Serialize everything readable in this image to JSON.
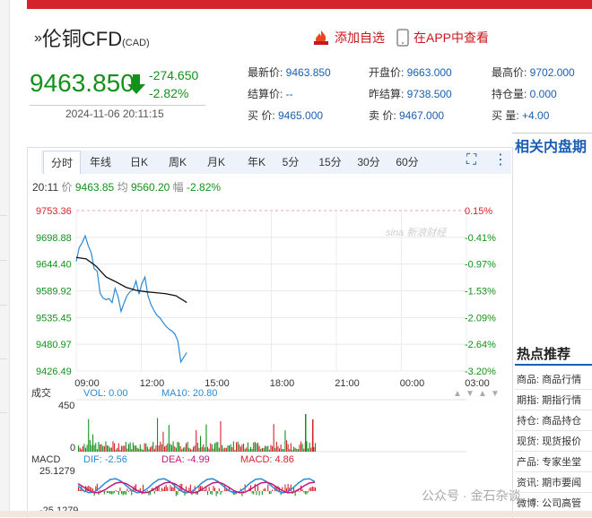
{
  "header": {
    "title_prefix": "»",
    "title": "伦铜CFD",
    "currency": "(CAD)",
    "add_watchlist": "添加自选",
    "view_in_app": "在APP中查看"
  },
  "quote": {
    "price": "9463.850",
    "change": "-274.650",
    "change_pct": "-2.82%",
    "timestamp": "2024-11-06 20:11:15",
    "fields": [
      {
        "label": "最新价:",
        "value": "9463.850"
      },
      {
        "label": "开盘价:",
        "value": "9663.000"
      },
      {
        "label": "最高价:",
        "value": "9702.000"
      },
      {
        "label": "结算价:",
        "value": "--"
      },
      {
        "label": "昨结算:",
        "value": "9738.500"
      },
      {
        "label": "持仓量:",
        "value": "0.000"
      },
      {
        "label": "买  价:",
        "value": "9465.000"
      },
      {
        "label": "卖  价:",
        "value": "9467.000"
      },
      {
        "label": "买  量:",
        "value": "+4.00"
      }
    ]
  },
  "tabs": [
    "分时",
    "年线",
    "日K",
    "周K",
    "月K",
    "年K",
    "5分",
    "15分",
    "30分",
    "60分"
  ],
  "info_line": {
    "time": "20:11",
    "price_label": "价",
    "price": "9463.85",
    "avg_label": "均",
    "avg": "9560.20",
    "amp_label": "幅",
    "amp": "-2.82%"
  },
  "sidebar": {
    "section1_title": "相关内盘期",
    "section2_title": "热点推荐",
    "hot_items": [
      {
        "label": "商品:",
        "value": "商品行情"
      },
      {
        "label": "期指:",
        "value": "期指行情"
      },
      {
        "label": "持仓:",
        "value": "商品持仓"
      },
      {
        "label": "现货:",
        "value": "现货报价"
      },
      {
        "label": "产品:",
        "value": "专家坐堂"
      },
      {
        "label": "资讯:",
        "value": "期市要闻"
      },
      {
        "label": "微博:",
        "value": "公司高管"
      }
    ]
  },
  "watermark": "公众号 · 金石杂谈",
  "chart_watermark": "sina 新浪财经",
  "chart_data": {
    "type": "line",
    "y_ticks_left": [
      "9753.36",
      "9698.88",
      "9644.40",
      "9589.92",
      "9535.45",
      "9480.97",
      "9426.49"
    ],
    "y_ticks_right": [
      "0.15%",
      "-0.41%",
      "-0.97%",
      "-1.53%",
      "-2.09%",
      "-2.64%",
      "-3.20%"
    ],
    "ylim": [
      9426.49,
      9753.36
    ],
    "x_ticks": [
      "09:00",
      "12:00",
      "15:00",
      "18:00",
      "21:00",
      "00:00",
      "03:00"
    ],
    "series": [
      {
        "name": "价",
        "color": "#2a8ad4",
        "x": [
          0,
          0.3,
          0.6,
          0.9,
          1.2,
          1.5,
          1.8,
          2.1,
          2.4,
          2.7,
          3.0,
          3.3,
          3.6,
          3.9,
          4.2,
          4.5,
          4.8,
          5.1,
          5.4,
          5.7,
          6.0,
          6.3,
          6.6,
          6.9,
          7.2,
          7.5,
          7.8,
          8.1,
          8.4,
          8.7,
          9.0,
          9.3,
          9.6,
          9.9,
          10.2,
          10.5,
          10.8,
          11.1
        ],
        "values": [
          9650,
          9678,
          9688,
          9702,
          9682,
          9668,
          9635,
          9630,
          9585,
          9575,
          9572,
          9574,
          9566,
          9595,
          9578,
          9548,
          9565,
          9580,
          9588,
          9592,
          9610,
          9583,
          9605,
          9618,
          9580,
          9562,
          9550,
          9540,
          9535,
          9526,
          9518,
          9512,
          9508,
          9502,
          9488,
          9445,
          9455,
          9464
        ]
      },
      {
        "name": "均",
        "color": "#111111",
        "x": [
          0,
          1,
          2,
          3,
          4,
          5,
          6,
          7,
          8,
          9,
          10,
          11.1
        ],
        "values": [
          9658,
          9655,
          9640,
          9618,
          9608,
          9597,
          9591,
          9588,
          9586,
          9584,
          9580,
          9566
        ]
      }
    ],
    "volume": {
      "label": "成交",
      "vol_label": "VOL: 0.00",
      "ma_label": "MA10: 20.80",
      "ymax": "450",
      "ymin": "0"
    },
    "macd": {
      "label": "MACD",
      "dif": "DIF: -2.56",
      "dea": "DEA: -4.99",
      "macd": "MACD: 4.86",
      "ytop": "25.1279",
      "ybot": "-25.1279"
    }
  },
  "colors": {
    "up": "#d5232b",
    "down": "#13911b",
    "link": "#1a5fb4"
  }
}
